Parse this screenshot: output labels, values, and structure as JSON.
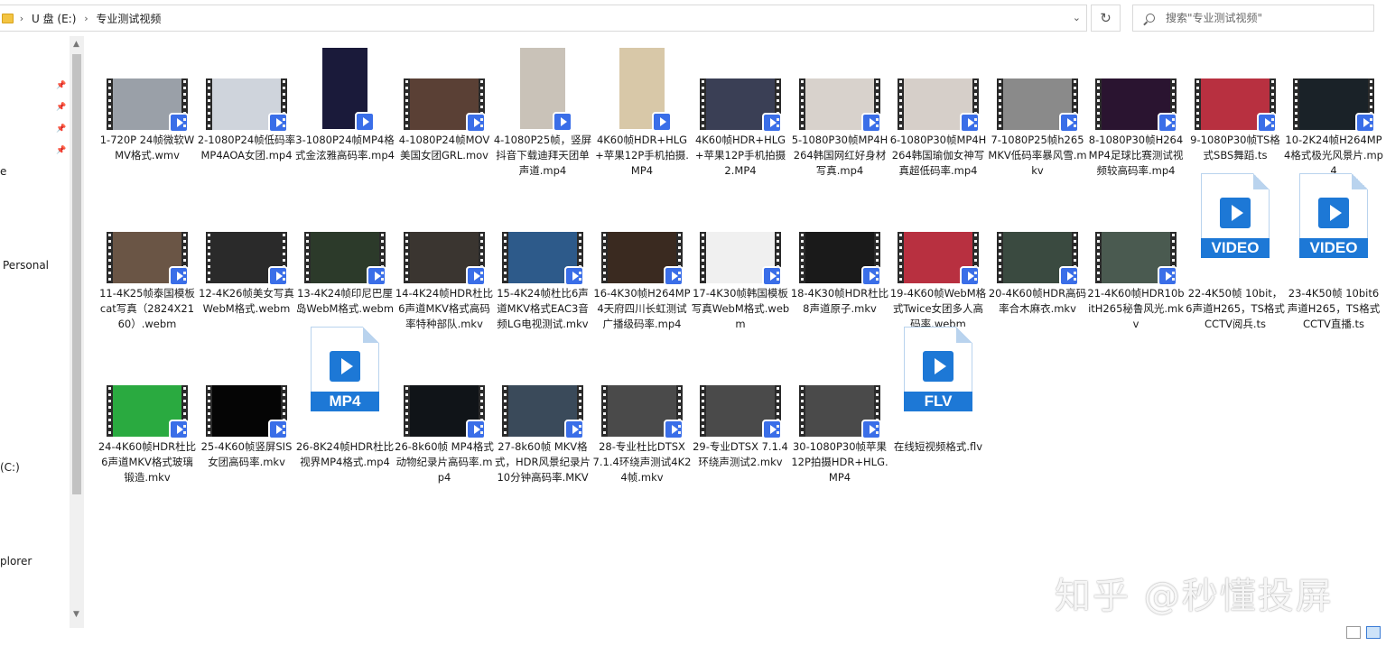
{
  "address": {
    "crumbs": [
      "U 盘 (E:)",
      "专业测试视频"
    ]
  },
  "search": {
    "placeholder": "搜索\"专业测试视频\""
  },
  "nav": {
    "items": [
      "e",
      "Personal",
      "(C:)",
      "plorer"
    ]
  },
  "files": [
    {
      "name": "1-720P 24帧微软WMV格式.wmv",
      "kind": "film"
    },
    {
      "name": "2-1080P24帧低码率MP4AOA女团.mp4",
      "kind": "film"
    },
    {
      "name": "3-1080P24帧MP4格式金泫雅高码率.mp4",
      "kind": "portrait"
    },
    {
      "name": "4-1080P24帧MOV美国女团GRL.mov",
      "kind": "film"
    },
    {
      "name": "4-1080P25帧，竖屏抖音下载迪拜天团单声道.mp4",
      "kind": "portrait"
    },
    {
      "name": "4K60帧HDR+HLG+苹果12P手机拍摄.MP4",
      "kind": "portrait"
    },
    {
      "name": "4K60帧HDR+HLG+苹果12P手机拍摄2.MP4",
      "kind": "film"
    },
    {
      "name": "5-1080P30帧MP4H264韩国网红好身材写真.mp4",
      "kind": "film"
    },
    {
      "name": "6-1080P30帧MP4H264韩国瑜伽女神写真超低码率.mp4",
      "kind": "film"
    },
    {
      "name": "7-1080P25帧h265MKV低码率暴风雪.mkv",
      "kind": "film"
    },
    {
      "name": "8-1080P30帧H264MP4足球比赛测试视频较高码率.mp4",
      "kind": "film"
    },
    {
      "name": "9-1080P30帧TS格式SBS舞蹈.ts",
      "kind": "film"
    },
    {
      "name": "10-2K24帧H264MP4格式极光风景片.mp4",
      "kind": "film"
    },
    {
      "name": "11-4K25帧泰国模板cat写真（2824X2160）.webm",
      "kind": "film"
    },
    {
      "name": "12-4K26帧美女写真WebM格式.webm",
      "kind": "film"
    },
    {
      "name": "13-4K24帧印尼巴厘岛WebM格式.webm",
      "kind": "film"
    },
    {
      "name": "14-4K24帧HDR杜比6声道MKV格式高码率特种部队.mkv",
      "kind": "film"
    },
    {
      "name": "15-4K24帧杜比6声道MKV格式EAC3音频LG电视测试.mkv",
      "kind": "film"
    },
    {
      "name": "16-4K30帧H264MP4天府四川长虹测试广播级码率.mp4",
      "kind": "film"
    },
    {
      "name": "17-4K30帧韩国模板写真WebM格式.webm",
      "kind": "film"
    },
    {
      "name": "18-4K30帧HDR杜比8声道原子.mkv",
      "kind": "film"
    },
    {
      "name": "19-4K60帧WebM格式Twice女团多人高码率.webm",
      "kind": "film"
    },
    {
      "name": "20-4K60帧HDR高码率合木麻衣.mkv",
      "kind": "film"
    },
    {
      "name": "21-4K60帧HDR10bitH265秘鲁风光.mkv",
      "kind": "film"
    },
    {
      "name": "22-4K50帧 10bit，6声道H265，TS格式CCTV阅兵.ts",
      "kind": "doc",
      "label": "VIDEO"
    },
    {
      "name": "23-4K50帧 10bit6声道H265，TS格式 CCTV直播.ts",
      "kind": "doc",
      "label": "VIDEO"
    },
    {
      "name": "24-4K60帧HDR杜比6声道MKV格式玻璃锻造.mkv",
      "kind": "film"
    },
    {
      "name": "25-4K60帧竖屏SIS女团高码率.mkv",
      "kind": "film"
    },
    {
      "name": "26-8K24帧HDR杜比视界MP4格式.mp4",
      "kind": "doc",
      "label": "MP4"
    },
    {
      "name": "26-8k60帧 MP4格式动物纪录片高码率.mp4",
      "kind": "film"
    },
    {
      "name": "27-8k60帧 MKV格式，HDR风景纪录片10分钟高码率.MKV",
      "kind": "film"
    },
    {
      "name": "28-专业杜比DTSX 7.1.4环绕声测试4K24帧.mkv",
      "kind": "film"
    },
    {
      "name": "29-专业DTSX 7.1.4环绕声测试2.mkv",
      "kind": "film"
    },
    {
      "name": "30-1080P30帧苹果12P拍摄HDR+HLG.MP4",
      "kind": "film"
    },
    {
      "name": "在线短视频格式.flv",
      "kind": "doc",
      "label": "FLV"
    }
  ],
  "watermark": "知乎 @秒懂投屏"
}
